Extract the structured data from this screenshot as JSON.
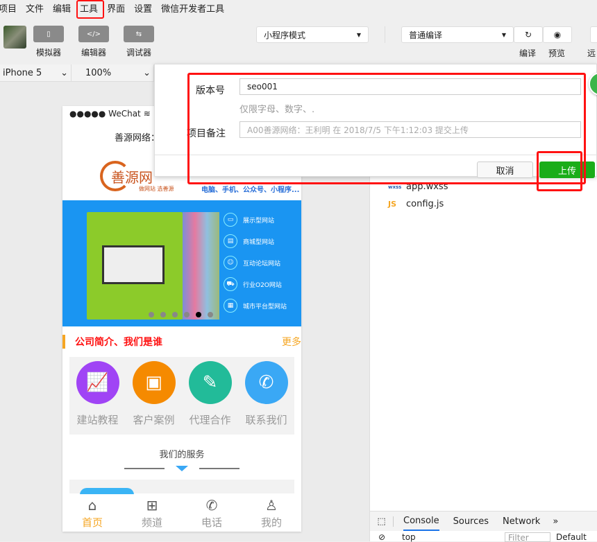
{
  "menu": [
    "项目",
    "文件",
    "编辑",
    "工具",
    "界面",
    "设置",
    "微信开发者工具"
  ],
  "toolbar": {
    "simulator": "模拟器",
    "editor": "编辑器",
    "debugger": "调试器",
    "mode_select": "小程序模式",
    "compile_select": "普通编译",
    "compile": "编译",
    "preview": "预览",
    "remote": "远"
  },
  "device": {
    "model": "iPhone 5",
    "zoom": "100%"
  },
  "phone": {
    "status_carrier": "●●●●● WeChat",
    "nav_title": "善源网络：专业网站策划、设...",
    "logo_text": "善源网",
    "logo_sub": "做网站 选善源",
    "slogan": "电脑、手机、公众号、小程序...",
    "banner_items": [
      "展示型网站",
      "商城型网站",
      "互动论坛网站",
      "行业O2O网站",
      "城市平台型网站"
    ],
    "section_title": "公司简介、我们是谁",
    "more": "更多",
    "grid": [
      {
        "label": "建站教程",
        "color": "#a044f5"
      },
      {
        "label": "客户案例",
        "color": "#f58a00"
      },
      {
        "label": "代理合作",
        "color": "#22bb99"
      },
      {
        "label": "联系我们",
        "color": "#3aa8f5"
      }
    ],
    "services_title": "我们的服务",
    "tabs": [
      {
        "label": "首页",
        "icon": "home-icon"
      },
      {
        "label": "频道",
        "icon": "grid-icon"
      },
      {
        "label": "电话",
        "icon": "phone-icon"
      },
      {
        "label": "我的",
        "icon": "user-icon"
      }
    ]
  },
  "files": [
    "app.wxss",
    "config.js"
  ],
  "devtools": {
    "tabs": [
      "Console",
      "Sources",
      "Network"
    ],
    "context": "top",
    "filter": "Filter",
    "levels": "Default"
  },
  "dialog": {
    "version_label": "版本号",
    "version_value": "seo001",
    "version_hint": "仅限字母、数字、.",
    "note_label": "项目备注",
    "note_placeholder": "A00善源网络：王利明 在 2018/7/5 下午1:12:03 提交上传",
    "cancel": "取消",
    "upload": "上传"
  },
  "colors": {
    "accent": "#1aad19",
    "highlight": "#ff1111",
    "tab_active": "#f5a623"
  }
}
